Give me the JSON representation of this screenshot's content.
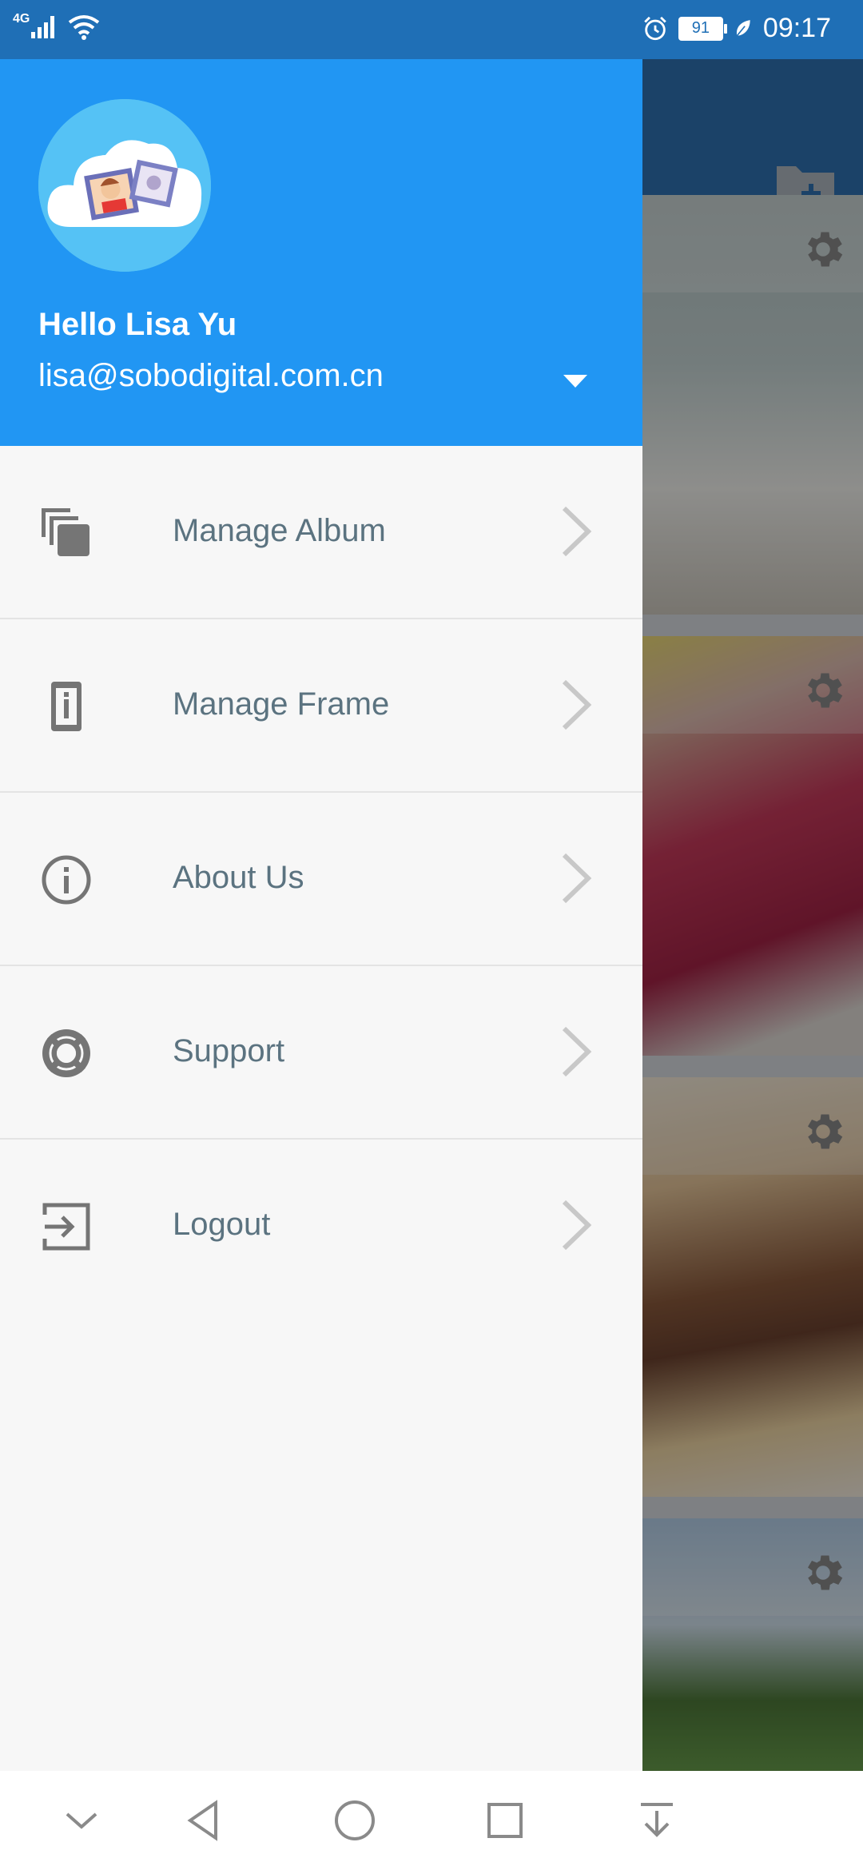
{
  "status_bar": {
    "network": "4G",
    "battery": "91",
    "time": "09:17"
  },
  "drawer": {
    "greeting": "Hello Lisa Yu",
    "email": "lisa@sobodigital.com.cn",
    "menu": [
      {
        "label": "Manage Album",
        "icon": "albums-icon"
      },
      {
        "label": "Manage Frame",
        "icon": "frame-device-icon"
      },
      {
        "label": "About Us",
        "icon": "info-icon"
      },
      {
        "label": "Support",
        "icon": "lifebuoy-icon"
      },
      {
        "label": "Logout",
        "icon": "logout-icon"
      }
    ]
  },
  "colors": {
    "header": "#2196f3",
    "status_bar": "#1f6fb6",
    "menu_text": "#5b7380",
    "icon": "#757575",
    "chevron": "#c8c8c8"
  },
  "navbar": [
    "collapse-icon",
    "back-icon",
    "home-icon",
    "recents-icon",
    "pull-down-icon"
  ]
}
